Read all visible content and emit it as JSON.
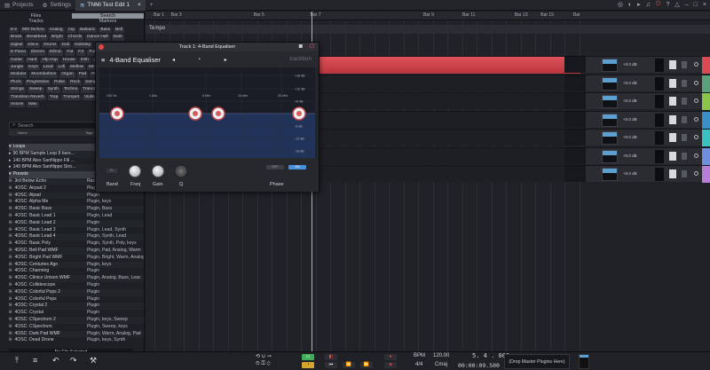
{
  "titlebar": {
    "tabs": [
      {
        "icon": "folder-icon",
        "label": "Projects"
      },
      {
        "icon": "gear-icon",
        "label": "Settings"
      },
      {
        "icon": "waveform-icon",
        "label": "TNMi Test Edit 1"
      }
    ],
    "add_tab": "+"
  },
  "browser": {
    "tabs_row1": [
      "Files",
      "Search"
    ],
    "tabs_row2": [
      "Tracks",
      "Markers"
    ],
    "tags": [
      "8-2",
      "909 Techno",
      "Analog",
      "Arp",
      "Balearic",
      "Bass",
      "Bell",
      "Brass",
      "Breakbeat",
      "Bright",
      "Chords",
      "Dance Hall",
      "Dark",
      "Digital",
      "Disco",
      "Drums",
      "Dub",
      "Dubstep",
      "Dulcimer",
      "E-Piano",
      "Electro",
      "Ethnic",
      "Fat",
      "FX",
      "Funk",
      "Garage",
      "Guitar",
      "Hard",
      "Hip Hop",
      "House",
      "Irish",
      "Jazz",
      "Juke",
      "Jungle",
      "Keys",
      "Lead",
      "Lofi",
      "Mellow",
      "Minimal",
      "Mixing",
      "Modular",
      "Moombahton",
      "Organ",
      "Pad",
      "Pattern",
      "Piano",
      "Pluck",
      "Progressive",
      "Pulse",
      "Rock",
      "Sample",
      "Soul",
      "Strings",
      "Sweep",
      "Synth",
      "Techno",
      "Trance",
      "Transition Reverb",
      "Trap",
      "Trumpet",
      "Violin",
      "Vocal",
      "Vocal",
      "Voices",
      "Wav"
    ],
    "search_placeholder": "Search",
    "col_name": "Name",
    "col_tags": "Tags",
    "files": [
      {
        "name": "Loops",
        "tags": "",
        "section": true
      },
      {
        "name": "90 BPM Sample Loop 8 bars...",
        "tags": ""
      },
      {
        "name": "140 BPM Alex Sanfilippo Fill ...",
        "tags": ""
      },
      {
        "name": "140 BPM Alex Sanfilippo Stro...",
        "tags": ""
      },
      {
        "name": "Presets",
        "tags": "",
        "section": true
      },
      {
        "name": "3rd Below Echo",
        "tags": "Rack"
      },
      {
        "name": "4OSC: Airpad 2",
        "tags": "Plugin"
      },
      {
        "name": "4OSC: Alpad",
        "tags": "Plugin"
      },
      {
        "name": "4OSC: Alpha Me",
        "tags": "Plugin, keys"
      },
      {
        "name": "4OSC: Basic Bass",
        "tags": "Plugin, Bass"
      },
      {
        "name": "4OSC: Basic Lead 1",
        "tags": "Plugin, Lead"
      },
      {
        "name": "4OSC: Basic Lead 2",
        "tags": "Plugin"
      },
      {
        "name": "4OSC: Basic Lead 3",
        "tags": "Plugin, Lead, Synth"
      },
      {
        "name": "4OSC: Basic Lead 4",
        "tags": "Plugin, Synth, Lead"
      },
      {
        "name": "4OSC: Basic Poly",
        "tags": "Plugin, Synth, Poly, keys"
      },
      {
        "name": "4OSC: Bell Pad WMF",
        "tags": "Plugin, Pad, Analog, Warm"
      },
      {
        "name": "4OSC: Bright Pad WMF",
        "tags": "Plugin, Bright, Warm, Analog"
      },
      {
        "name": "4OSC: Centuries Ago",
        "tags": "Plugin, keys"
      },
      {
        "name": "4OSC: Charming",
        "tags": "Plugin"
      },
      {
        "name": "4OSC: Clinics Unison WMF",
        "tags": "Plugin, Analog, Bass, Leac"
      },
      {
        "name": "4OSC: Collidescope",
        "tags": "Plugin"
      },
      {
        "name": "4OSC: Colorful Pops 2",
        "tags": "Plugin"
      },
      {
        "name": "4OSC: Colorful Pops",
        "tags": "Plugin"
      },
      {
        "name": "4OSC: Crystal 2",
        "tags": "Plugin"
      },
      {
        "name": "4OSC: Crystal",
        "tags": "Plugin"
      },
      {
        "name": "4OSC: CSpectrum 2",
        "tags": "Plugin, keys, Sweep"
      },
      {
        "name": "4OSC: CSpectrum",
        "tags": "Plugin, Sweep, keys"
      },
      {
        "name": "4OSC: Dark Pad WMF",
        "tags": "Plugin, Warm, Analog, Pad"
      },
      {
        "name": "4OSC: Dead Drone",
        "tags": "Plugin, keys, Synth"
      }
    ],
    "status": "No File Selected"
  },
  "arrangement": {
    "bars": [
      {
        "label": "Bar 1",
        "pos": 0.035
      },
      {
        "label": "Bar 3",
        "pos": 0.075
      },
      {
        "label": "Bar 5",
        "pos": 0.265
      },
      {
        "label": "Bar 7",
        "pos": 0.395
      },
      {
        "label": "Bar 9",
        "pos": 0.655
      },
      {
        "label": "Bar 11",
        "pos": 0.745
      },
      {
        "label": "Bar 13",
        "pos": 0.865
      },
      {
        "label": "Bar 15",
        "pos": 0.925
      },
      {
        "label": "Bar",
        "pos": 1.0
      }
    ],
    "tempo_label": "Tempo",
    "track_db": "+0.0 dB",
    "track_colors": [
      "#d94a52",
      "#5aa17b",
      "#8cc34a",
      "#3a8fc6",
      "#3ac2c0",
      "#6f8fdd",
      "#b77ed8"
    ]
  },
  "plugin": {
    "window_title": "Track 1: 4-Band Equaliser",
    "plugin_name": "4-Band Equaliser",
    "brand": "tracktion",
    "freq_labels": [
      "100 Hz",
      "1 kHz",
      "5 kHz",
      "10 kHz",
      "20 kHz"
    ],
    "db_labels": [
      "+18 dB",
      "+12 dB",
      "+6 dB",
      "0 dB",
      "-6 dB",
      "-12 dB",
      "-18 dB"
    ],
    "controls": [
      "Band",
      "Freq",
      "Gain",
      "Q"
    ],
    "phase_label": "Phase",
    "btn_off": "OFF",
    "btn_on": "ON",
    "band_btn": "B1"
  },
  "transport": {
    "bpm_label": "BPM",
    "bpm_value": "120.00",
    "position": "5. 4 . 000",
    "time_sig": "4/4",
    "key": "Cmaj",
    "time": "00:00:09.500",
    "drop_master": "(Drop Master Plugins Here)"
  }
}
